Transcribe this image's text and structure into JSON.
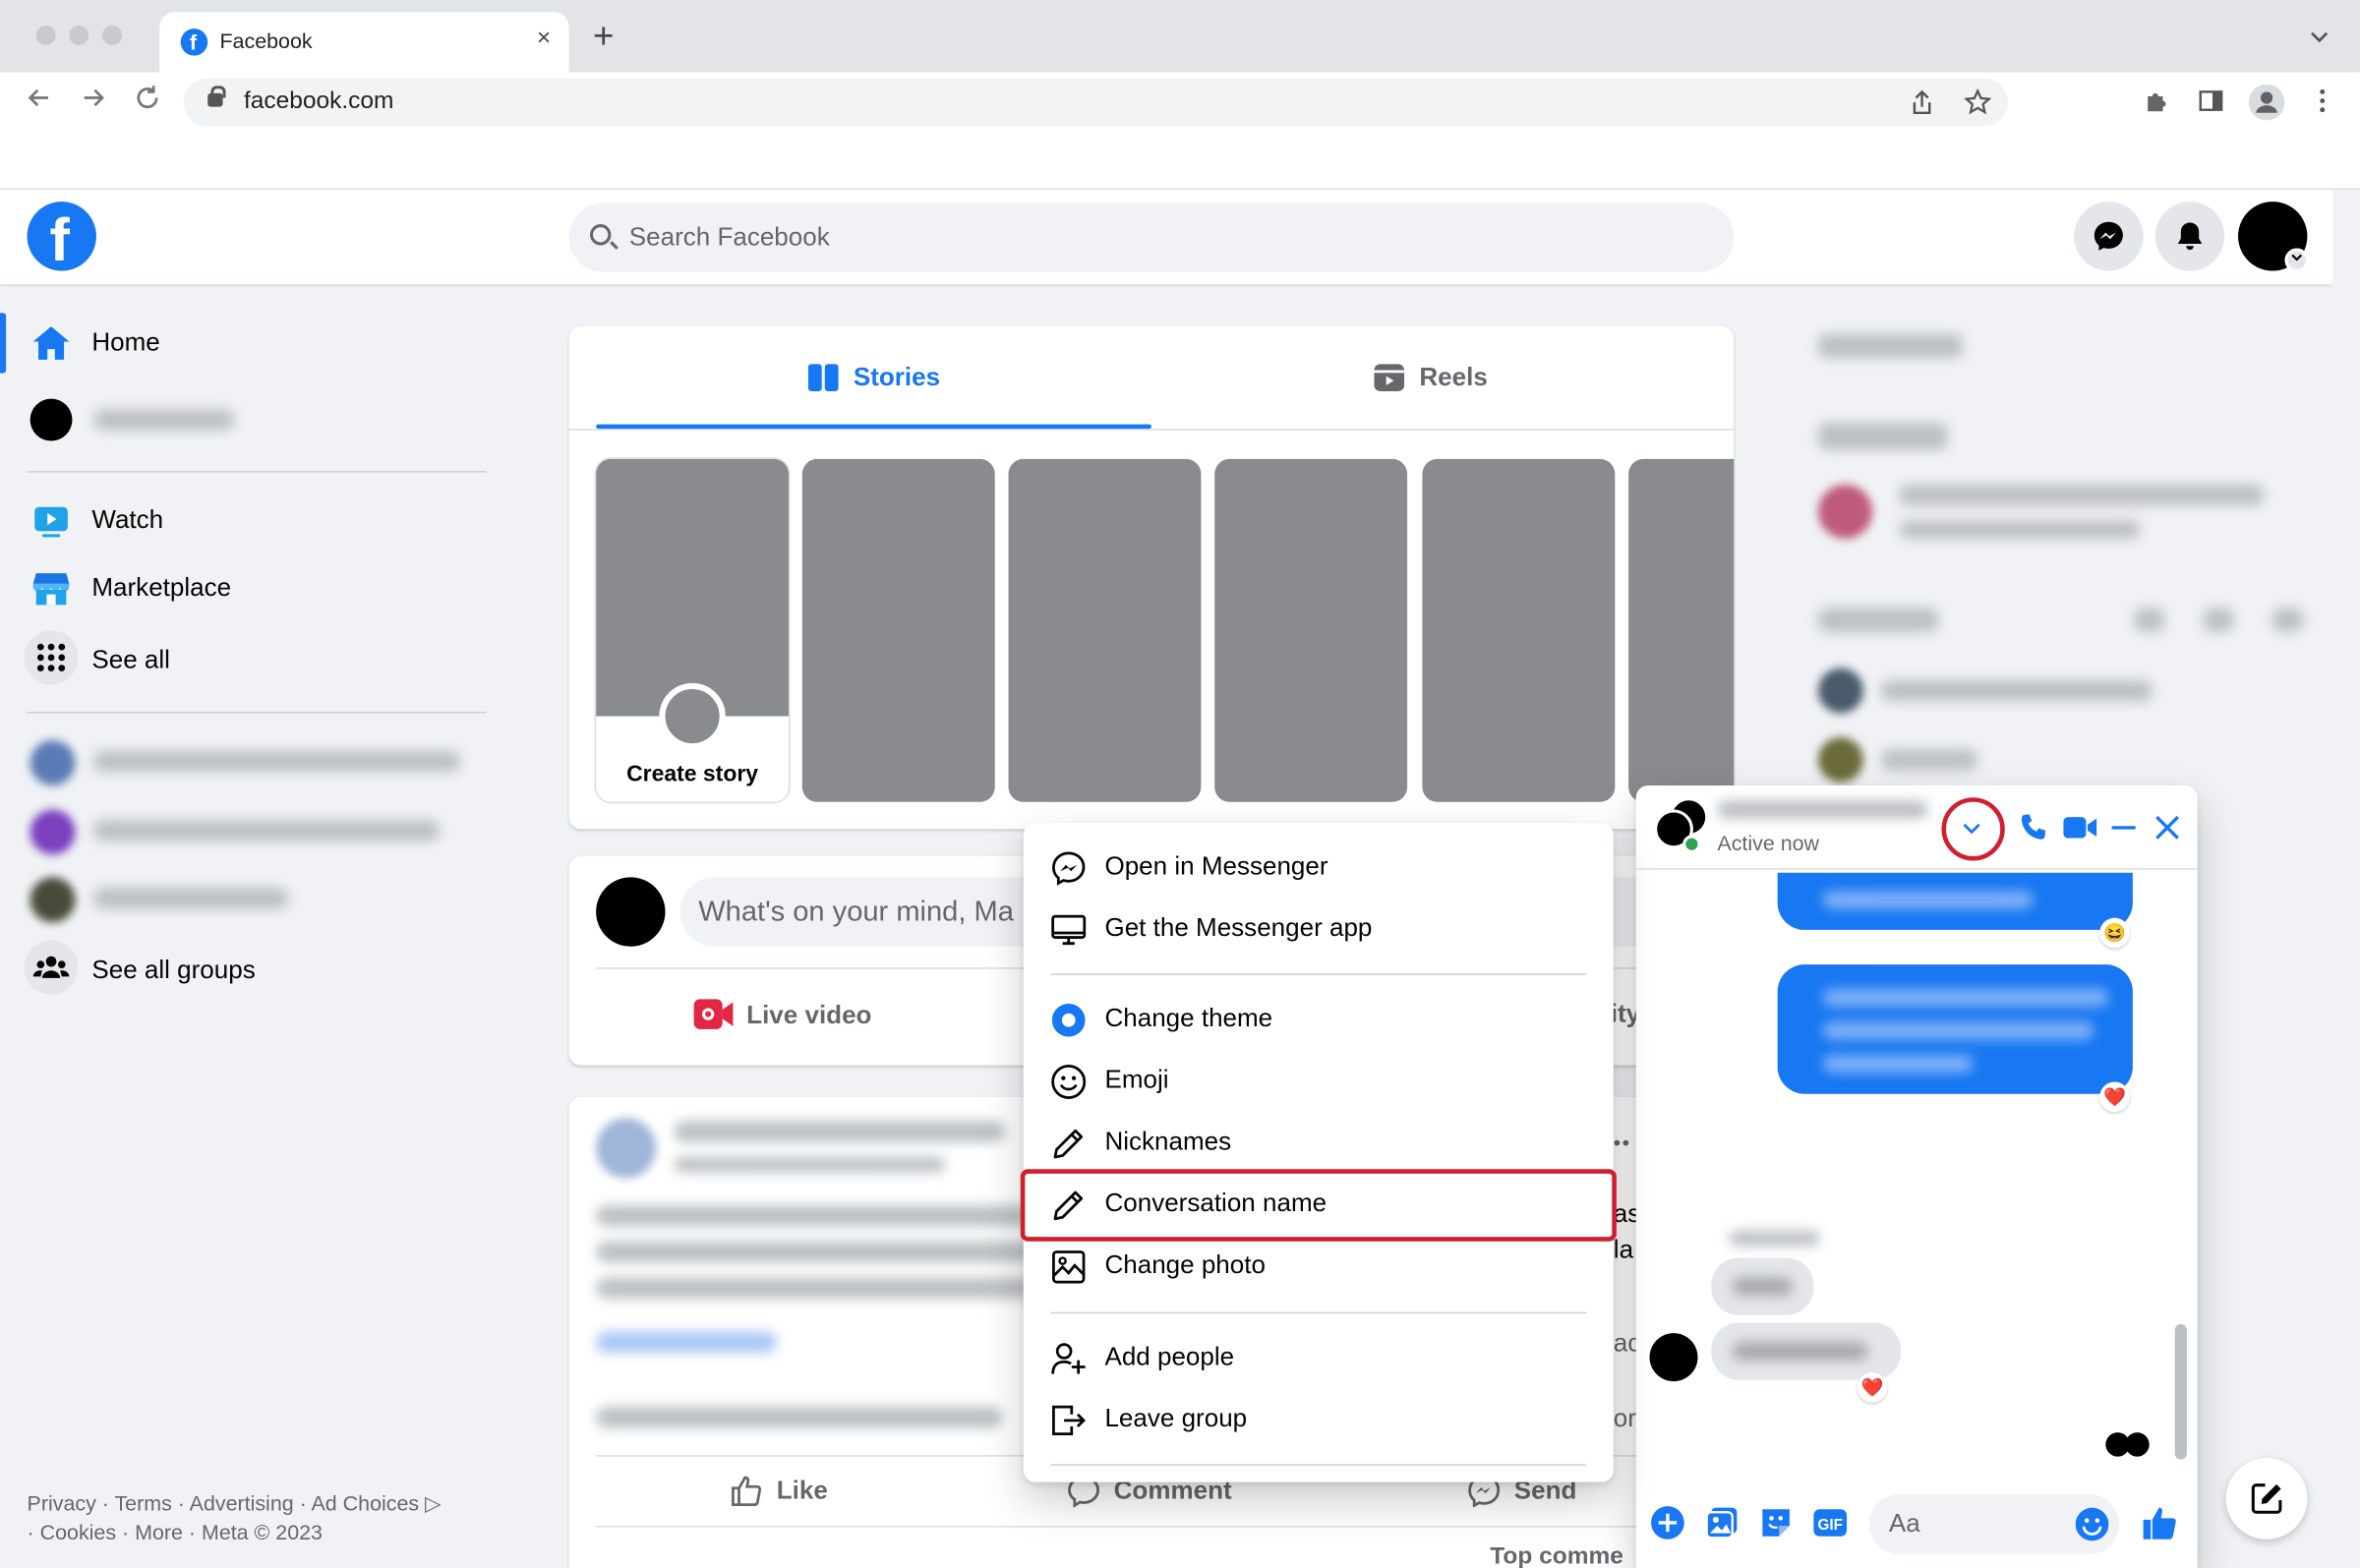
{
  "browser": {
    "tab_title": "Facebook",
    "tab_close": "×",
    "new_tab": "+",
    "url": "facebook.com"
  },
  "header": {
    "logo_letter": "f",
    "search_placeholder": "Search Facebook"
  },
  "sidebar": {
    "items": [
      {
        "label": "Home"
      },
      {
        "label": "Watch"
      },
      {
        "label": "Marketplace"
      },
      {
        "label": "See all"
      },
      {
        "label": "See all groups"
      }
    ],
    "footer_line1": "Privacy · Terms · Advertising · Ad Choices ▷",
    "footer_line2": "· Cookies · More · Meta © 2023"
  },
  "stories": {
    "tab_stories": "Stories",
    "tab_reels": "Reels",
    "create_story": "Create story"
  },
  "composer": {
    "placeholder": "What's on your mind, Ma",
    "live_video": "Live video",
    "right_fragment": "ity"
  },
  "post": {
    "like": "Like",
    "comment": "Comment",
    "send": "Send",
    "top_comments": "Top comme",
    "fragments": [
      "as",
      "la",
      "ac",
      "or"
    ],
    "more": "•••"
  },
  "menu": {
    "items": [
      {
        "label": "Open in Messenger",
        "icon": "messenger-icon"
      },
      {
        "label": "Get the Messenger app",
        "icon": "desktop-icon"
      },
      {
        "label": "Change theme",
        "icon": "theme-icon"
      },
      {
        "label": "Emoji",
        "icon": "emoji-icon"
      },
      {
        "label": "Nicknames",
        "icon": "pencil-icon"
      },
      {
        "label": "Conversation name",
        "icon": "pencil-icon"
      },
      {
        "label": "Change photo",
        "icon": "image-icon"
      },
      {
        "label": "Add people",
        "icon": "add-person-icon"
      },
      {
        "label": "Leave group",
        "icon": "leave-icon"
      }
    ],
    "highlighted": "Conversation name"
  },
  "chat": {
    "status": "Active now",
    "input_placeholder": "Aa",
    "reactions": [
      "😆",
      "❤️",
      "❤️"
    ]
  },
  "colors": {
    "brand": "#1877f2",
    "highlight": "#d0202e",
    "story_placeholder": "#8a8b8f"
  }
}
